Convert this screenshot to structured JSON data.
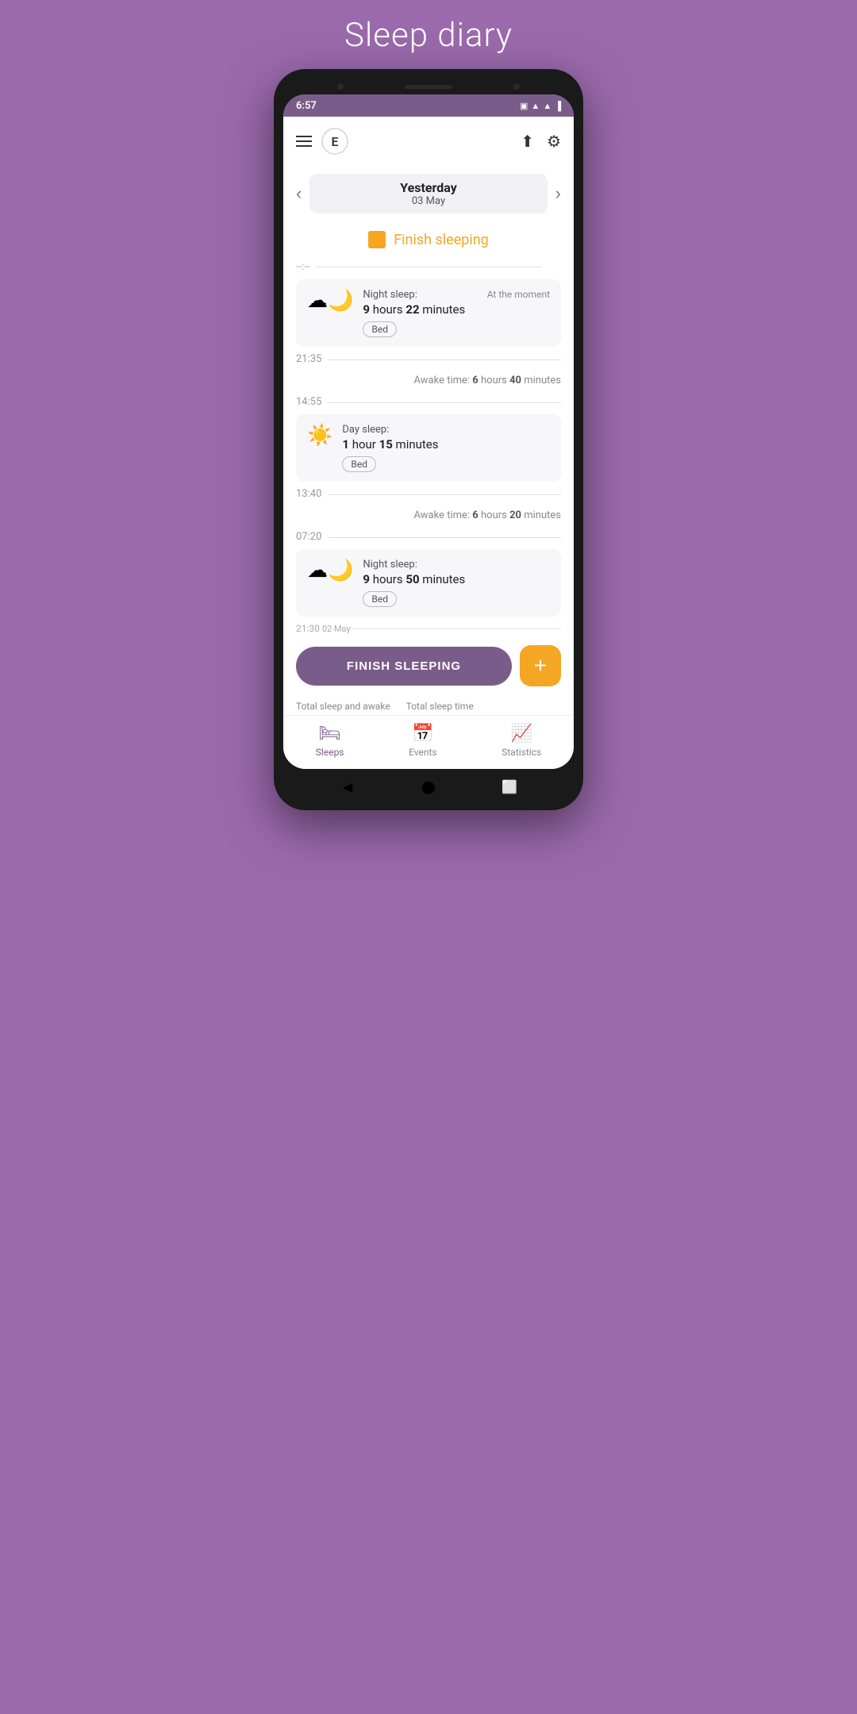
{
  "app": {
    "title": "Sleep diary"
  },
  "status_bar": {
    "time": "6:57",
    "icons": [
      "wifi",
      "signal",
      "battery"
    ]
  },
  "top_bar": {
    "user_initial": "E",
    "share_label": "share",
    "settings_label": "settings"
  },
  "date_nav": {
    "label": "Yesterday",
    "date": "03 May",
    "prev_arrow": "←",
    "next_arrow": "→"
  },
  "finish_banner": {
    "text": "Finish sleeping"
  },
  "timeline": [
    {
      "type": "dashed",
      "time": "--:--"
    },
    {
      "type": "sleep_block",
      "icon": "🌙",
      "sleep_type": "Night sleep:",
      "duration_prefix": "",
      "hours": "9",
      "hours_label": "hours",
      "minutes": "22",
      "minutes_label": "minutes",
      "badge": "Bed",
      "at_moment": "At the moment"
    },
    {
      "type": "time",
      "time": "21:35"
    },
    {
      "type": "awake",
      "prefix": "Awake time:",
      "hours": "6",
      "hours_label": "hours",
      "minutes": "40",
      "minutes_label": "minutes"
    },
    {
      "type": "time",
      "time": "14:55"
    },
    {
      "type": "sleep_block",
      "icon": "☀️",
      "sleep_type": "Day sleep:",
      "hours": "1",
      "hours_label": "hour",
      "minutes": "15",
      "minutes_label": "minutes",
      "badge": "Bed",
      "at_moment": ""
    },
    {
      "type": "time",
      "time": "13:40"
    },
    {
      "type": "awake",
      "prefix": "Awake time:",
      "hours": "6",
      "hours_label": "hours",
      "minutes": "20",
      "minutes_label": "minutes"
    },
    {
      "type": "time",
      "time": "07:20"
    },
    {
      "type": "sleep_block",
      "icon": "🌙",
      "sleep_type": "Night sleep:",
      "hours": "9",
      "hours_label": "hours",
      "minutes": "50",
      "minutes_label": "minutes",
      "badge": "Bed",
      "at_moment": ""
    },
    {
      "type": "time",
      "time": "21:30"
    }
  ],
  "cta": {
    "finish_label": "FINISH SLEEPING",
    "add_label": "+"
  },
  "summary": {
    "col1": "Total sleep and awake",
    "col2": "Total sleep time"
  },
  "bottom_nav": {
    "items": [
      {
        "label": "Sleeps",
        "icon": "🛏",
        "active": true
      },
      {
        "label": "Events",
        "icon": "📅",
        "active": false
      },
      {
        "label": "Statistics",
        "icon": "📊",
        "active": false
      }
    ]
  }
}
